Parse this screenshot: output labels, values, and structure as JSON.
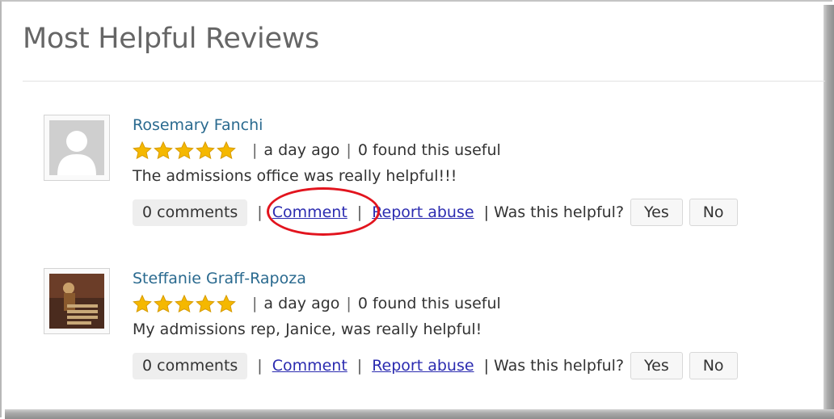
{
  "header": {
    "title": "Most Helpful Reviews"
  },
  "reviews": [
    {
      "name": "Rosemary Fanchi",
      "rating": 5,
      "time": "a day ago",
      "useful": "0 found this useful",
      "text": "The admissions office was really helpful!!!",
      "comments_label": "0 comments",
      "comment_link": "Comment",
      "report_link": "Report abuse",
      "helpful_question": "Was this helpful?",
      "yes_label": "Yes",
      "no_label": "No",
      "avatar": "default-user-avatar"
    },
    {
      "name": "Steffanie Graff-Rapoza",
      "rating": 5,
      "time": "a day ago",
      "useful": "0 found this useful",
      "text": "My admissions rep, Janice, was really helpful!",
      "comments_label": "0 comments",
      "comment_link": "Comment",
      "report_link": "Report abuse",
      "helpful_question": "Was this helpful?",
      "yes_label": "Yes",
      "no_label": "No",
      "avatar": "custom-photo-avatar"
    }
  ],
  "colors": {
    "name_link": "#2a6a8f",
    "action_link": "#2b2bb0",
    "star": "#f5b800",
    "highlight_circle": "#e2141e"
  }
}
